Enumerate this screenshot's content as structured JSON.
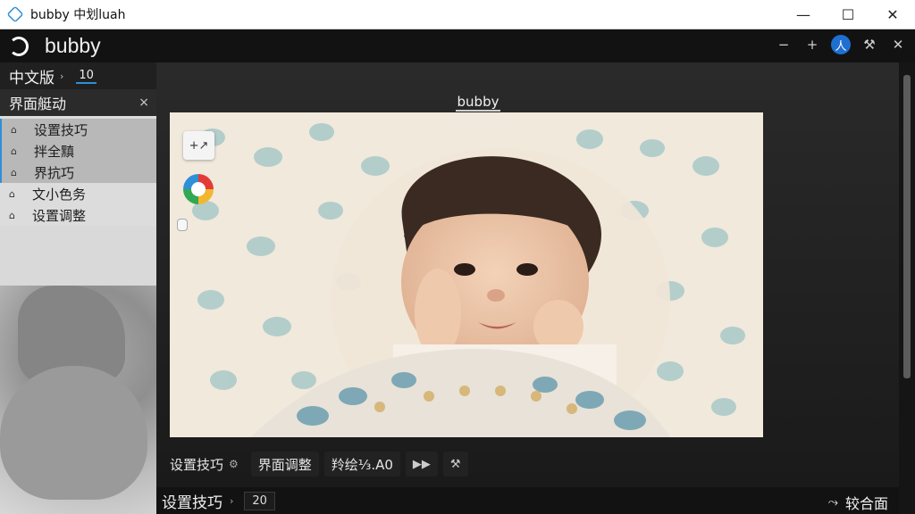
{
  "window": {
    "title": "bubby 中划luah",
    "minimize_glyph": "—",
    "maximize_glyph": "☐",
    "close_glyph": "✕"
  },
  "header": {
    "app_name": "bubby",
    "actions": {
      "minus_glyph": "−",
      "plus_glyph": "+",
      "avatar_text": "人",
      "tools_glyph": "⚒",
      "close_glyph": "✕"
    }
  },
  "left_panel": {
    "language_select": "中文版",
    "chevron_glyph": "›",
    "number_value": "10",
    "panel_title": "界面艇动",
    "close_glyph": "×",
    "items": [
      {
        "label": "设置技巧",
        "icon": "⌂",
        "active": true
      },
      {
        "label": "拌全黰",
        "icon": "⌂",
        "active": true
      },
      {
        "label": "界抗巧",
        "icon": "⌂",
        "active": true
      },
      {
        "label": "文小色务",
        "icon": "⌂",
        "active": false
      },
      {
        "label": "设置调整",
        "icon": "⌂",
        "active": false
      }
    ]
  },
  "viewer": {
    "caption": "bubby",
    "plus_glyph": "+↗"
  },
  "toolbar": {
    "settings_label": "设置技巧",
    "settings_gear": "⚙",
    "adjust_label": "界面调整",
    "zoom_label": "羚绘⅓.A0",
    "next_glyph": "▶▶",
    "tools_glyph": "⚒"
  },
  "statusbar": {
    "left_label": "设置技巧",
    "chevron_glyph": "›",
    "value": "20",
    "right_icon": "⤳",
    "right_label": "较合面"
  },
  "colors": {
    "accent": "#2f8fd8",
    "background": "#1e1e1e"
  }
}
